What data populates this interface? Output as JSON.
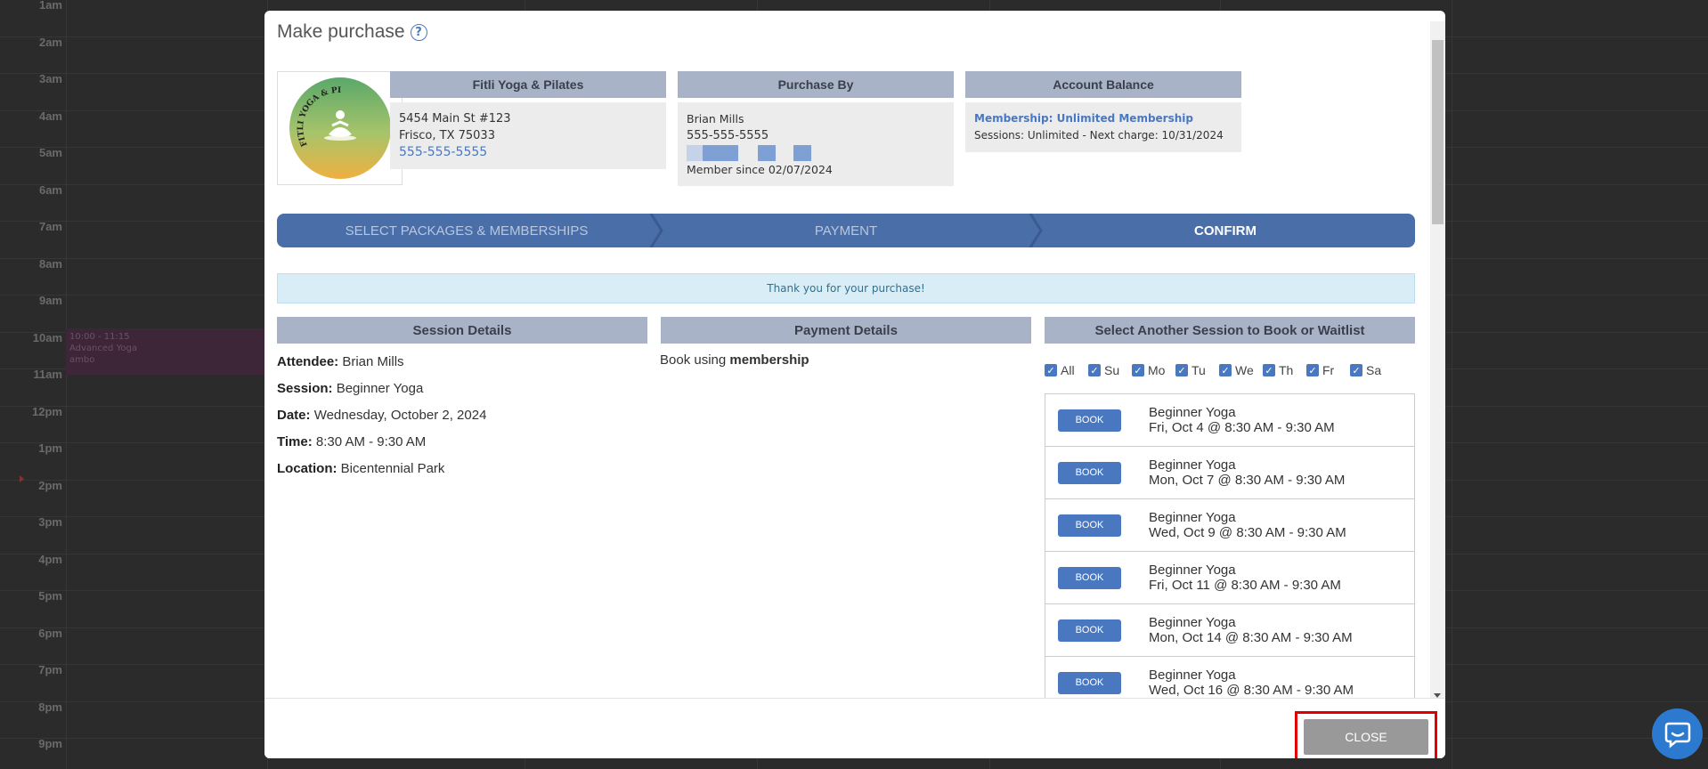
{
  "calendar": {
    "hours": [
      "1am",
      "2am",
      "3am",
      "4am",
      "5am",
      "6am",
      "7am",
      "8am",
      "9am",
      "10am",
      "11am",
      "12pm",
      "1pm",
      "2pm",
      "3pm",
      "4pm",
      "5pm",
      "6pm",
      "7pm",
      "8pm",
      "9pm"
    ],
    "event": {
      "time": "10:00 - 11:15",
      "title": "Advanced Yoga",
      "instructor": "ambo"
    }
  },
  "modal": {
    "title": "Make purchase",
    "help_icon": "question-circle-icon",
    "studio": {
      "header": "Fitli Yoga & Pilates",
      "address1": "5454 Main St #123",
      "address2": "Frisco, TX 75033",
      "phone": "555-555-5555",
      "logo_text": "FITLI YOGA & PILATES"
    },
    "purchase_by": {
      "header": "Purchase By",
      "name": "Brian Mills",
      "phone": "555-555-5555",
      "member_since": "Member since 02/07/2024"
    },
    "account_balance": {
      "header": "Account Balance",
      "membership": "Membership: Unlimited Membership",
      "sessions": "Sessions: Unlimited -  Next charge: 10/31/2024"
    },
    "steps": [
      "SELECT PACKAGES & MEMBERSHIPS",
      "PAYMENT",
      "CONFIRM"
    ],
    "alert": "Thank you for your purchase!",
    "session_details": {
      "header": "Session Details",
      "attendee_label": "Attendee:",
      "attendee": "Brian Mills",
      "session_label": "Session:",
      "session": "Beginner Yoga",
      "date_label": "Date:",
      "date": "Wednesday, October 2, 2024",
      "time_label": "Time:",
      "time": "8:30 AM - 9:30 AM",
      "location_label": "Location:",
      "location": "Bicentennial Park"
    },
    "payment_details": {
      "header": "Payment Details",
      "text": "Book using",
      "method": "membership"
    },
    "another_session": {
      "header": "Select Another Session to Book or Waitlist",
      "days": [
        "All",
        "Su",
        "Mo",
        "Tu",
        "We",
        "Th",
        "Fr",
        "Sa"
      ],
      "book_label": "BOOK",
      "sessions": [
        {
          "name": "Beginner Yoga",
          "when": "Fri, Oct 4 @ 8:30 AM - 9:30 AM"
        },
        {
          "name": "Beginner Yoga",
          "when": "Mon, Oct 7 @ 8:30 AM - 9:30 AM"
        },
        {
          "name": "Beginner Yoga",
          "when": "Wed, Oct 9 @ 8:30 AM - 9:30 AM"
        },
        {
          "name": "Beginner Yoga",
          "when": "Fri, Oct 11 @ 8:30 AM - 9:30 AM"
        },
        {
          "name": "Beginner Yoga",
          "when": "Mon, Oct 14 @ 8:30 AM - 9:30 AM"
        },
        {
          "name": "Beginner Yoga",
          "when": "Wed, Oct 16 @ 8:30 AM - 9:30 AM"
        }
      ]
    },
    "close_label": "CLOSE"
  },
  "colors": {
    "accent": "#4a78c0",
    "step_bar": "#4a6ea8",
    "header_bg": "#a9b3c8",
    "highlight": "#e00000"
  }
}
